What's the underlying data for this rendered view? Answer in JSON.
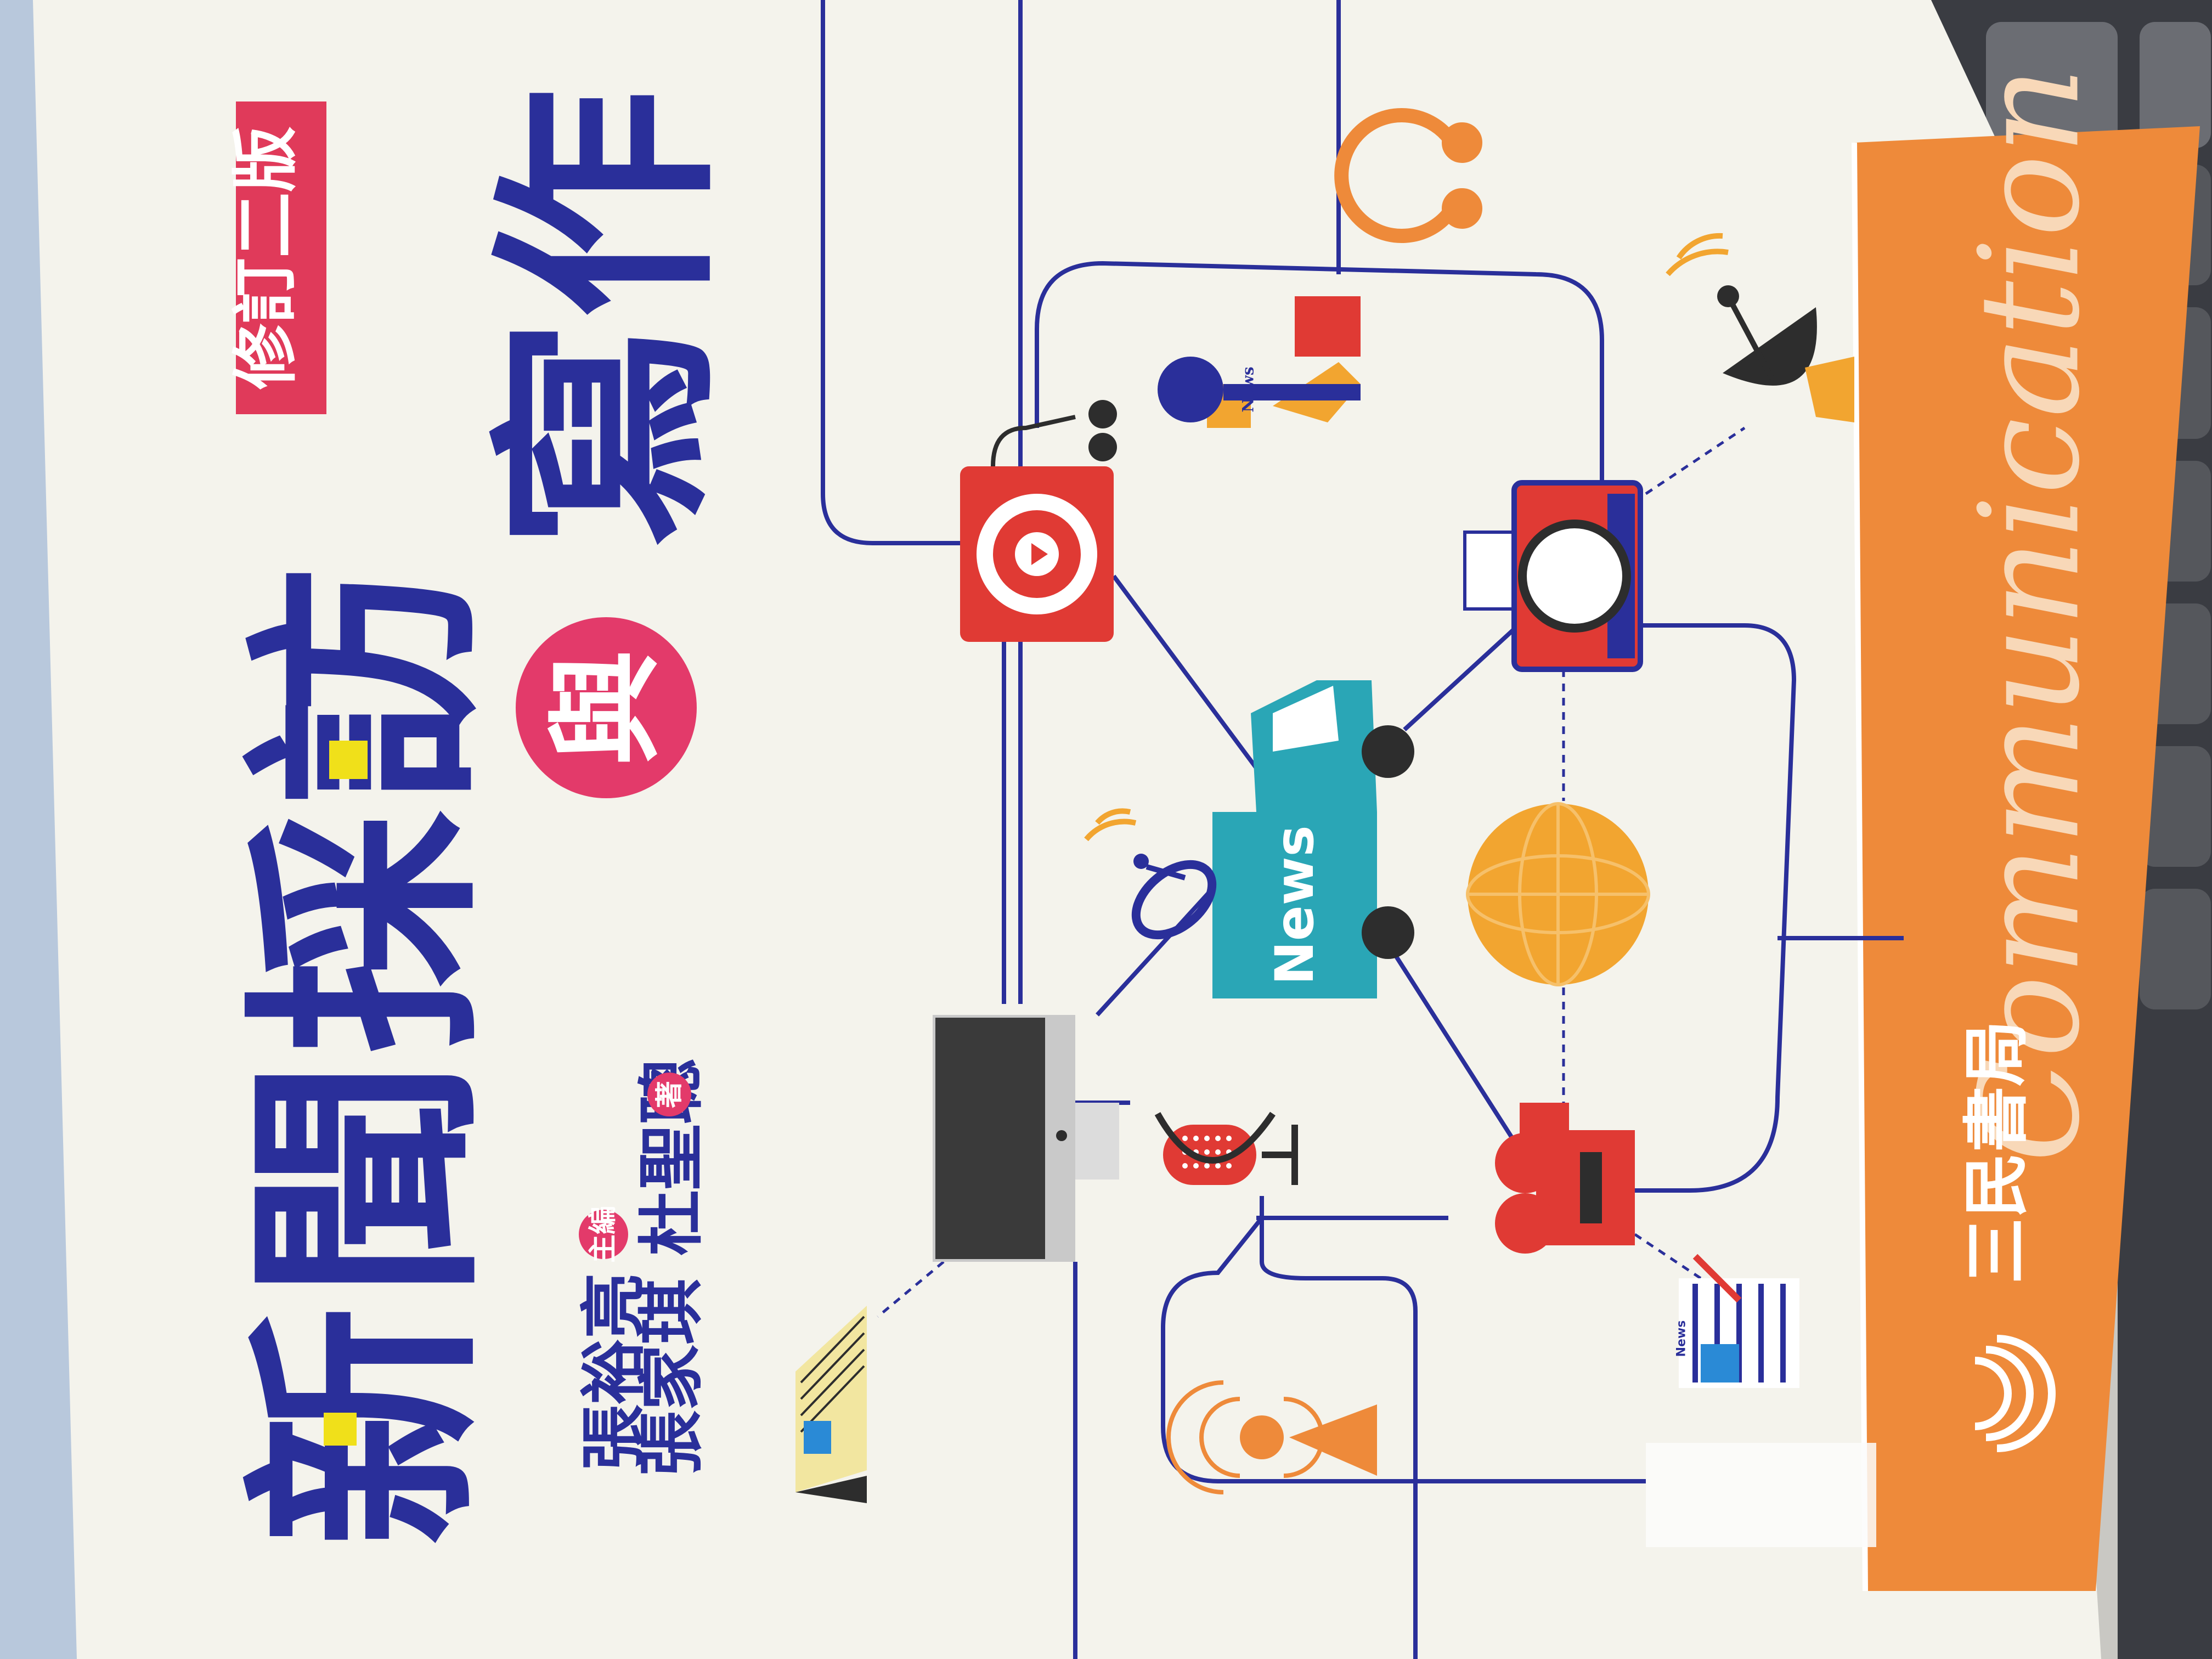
{
  "book": {
    "title_part1": "新聞採訪",
    "connector": "與",
    "title_part2": "寫作",
    "edition_badge": "修訂二版",
    "editor_name": "張裕亮",
    "editor_role": "主編",
    "authors": "張家琪 杜聖聰",
    "authors_role": "著",
    "spine_word": "Communication",
    "publisher": "三民書局",
    "truck_label": "News",
    "mic_label": "News",
    "newspaper_label": "News"
  },
  "icons": [
    "news-truck-icon",
    "globe-icon",
    "camera-icon",
    "video-camera-icon",
    "monitor-icon",
    "radio-microphone-icon",
    "satellite-dish-icon",
    "headphones-icon",
    "music-player-icon",
    "newspaper-icon",
    "notepad-icon",
    "broadcast-tower-icon",
    "reporter-microphone-icon"
  ],
  "colors": {
    "cover": "#f4f3ec",
    "navy": "#2a2f9a",
    "orange": "#ee8a3a",
    "red": "#e03a34",
    "teal": "#2aa6b6",
    "gold": "#f2a530",
    "pink": "#e33a6a",
    "yellow": "#f0e01a",
    "desk": "#2b2d33"
  }
}
